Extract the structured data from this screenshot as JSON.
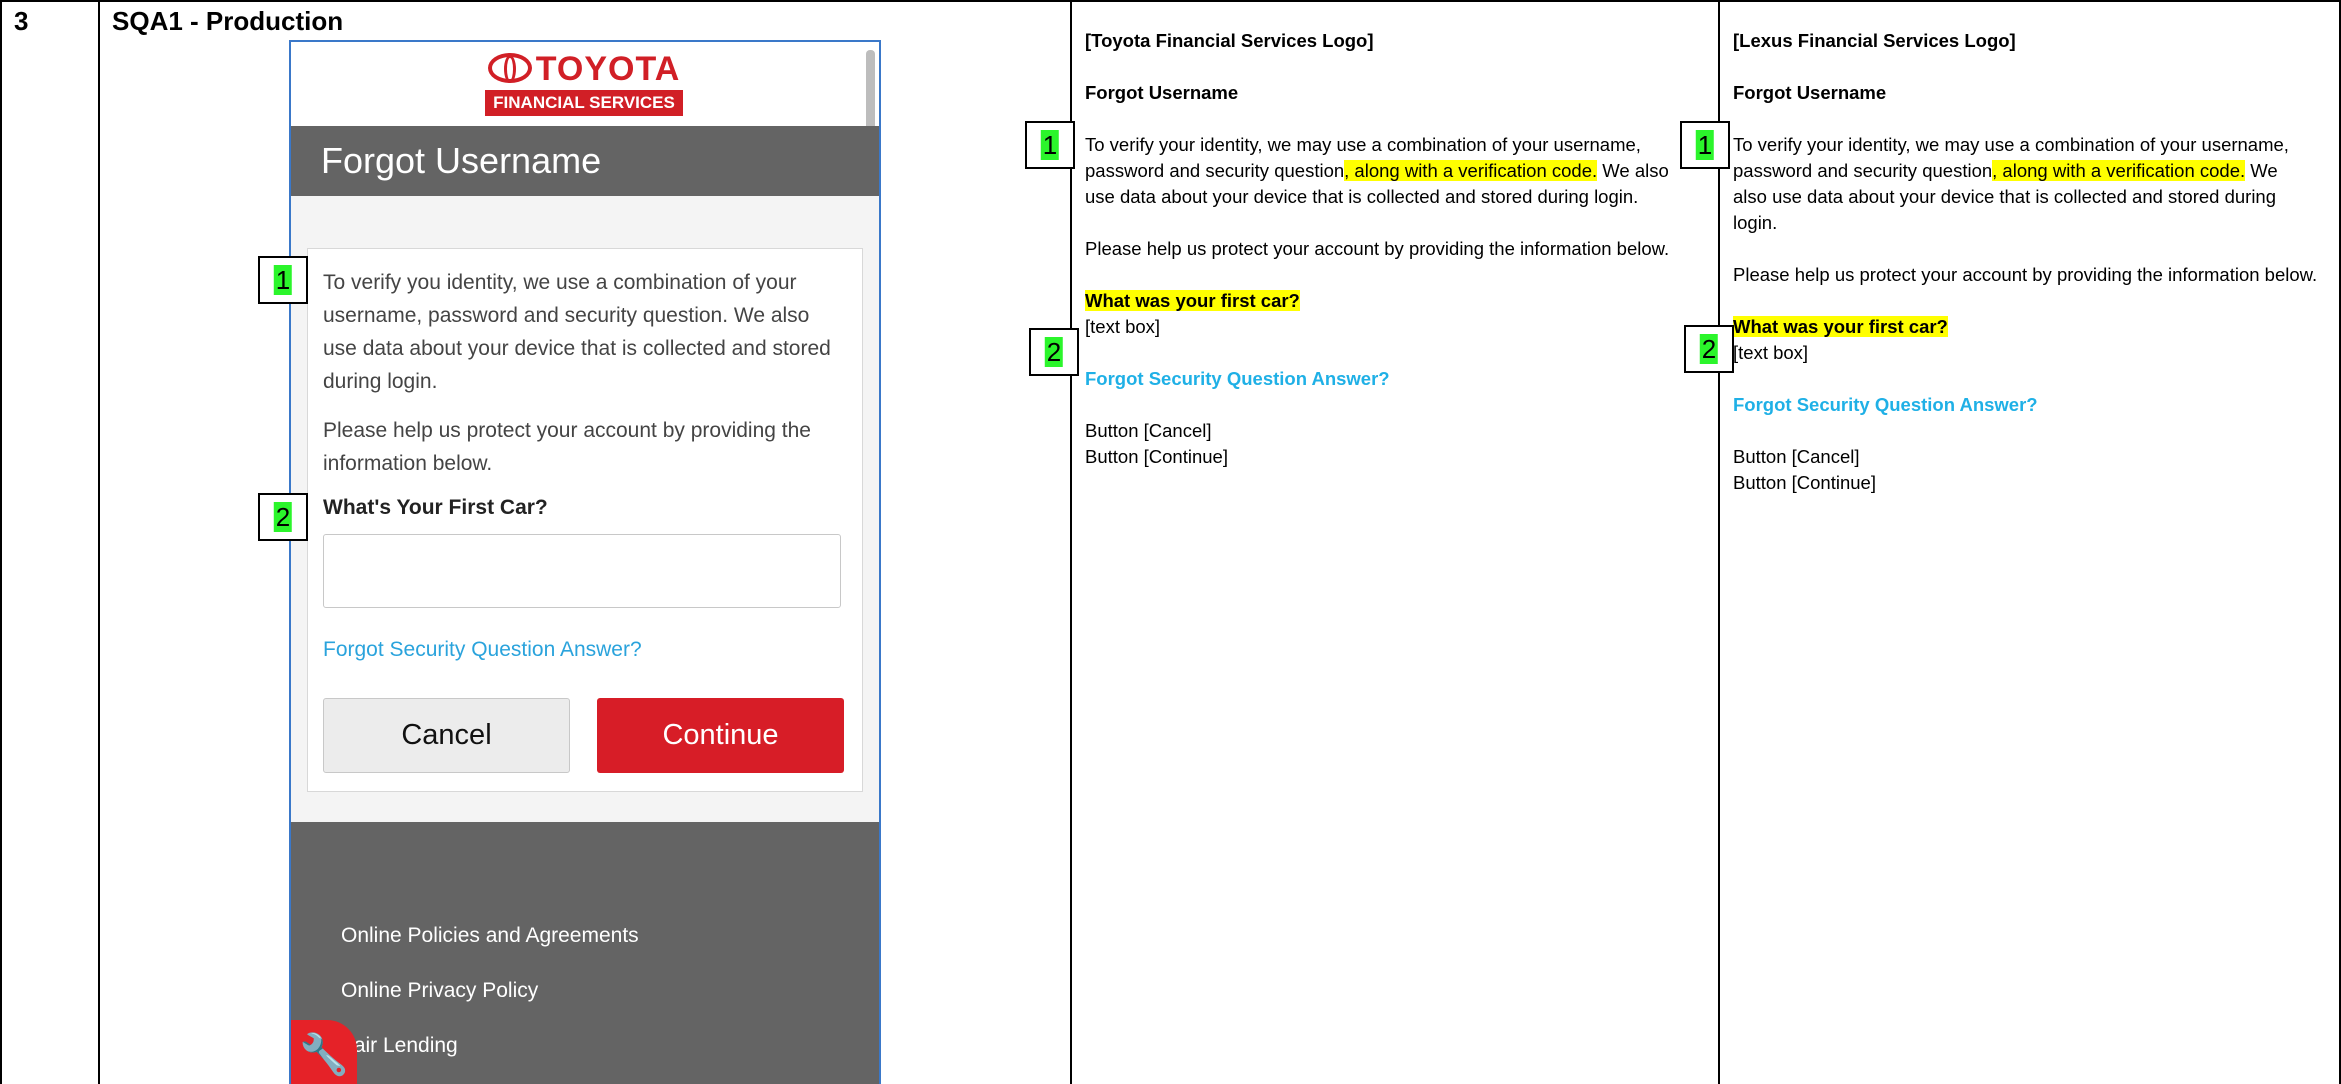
{
  "row": {
    "number": "3",
    "title": "SQA1 - Production"
  },
  "screenshot": {
    "logo": {
      "top": "TOYOTA",
      "bottom": "FINANCIAL SERVICES"
    },
    "page_title": "Forgot Username",
    "intro": "To verify you identity, we use a combination of your username, password and security question. We also use data about your device that is collected and stored during login.",
    "help_text": "Please help us protect your account by providing the information below.",
    "question": "What's Your First Car?",
    "answer_placeholder": "",
    "forgot_link": "Forgot Security Question Answer?",
    "cancel_label": "Cancel",
    "continue_label": "Continue",
    "footer_links": [
      "Online Policies and Agreements",
      "Online Privacy Policy",
      "Fair Lending"
    ],
    "callouts": [
      "1",
      "2"
    ]
  },
  "toyota_spec": {
    "logo_placeholder": "[Toyota Financial Services Logo]",
    "heading": "Forgot Username",
    "intro_plain": "To verify your identity, we may use a combination of your username, password and security question",
    "intro_highlight": ", along with a verification code.",
    "intro_rest": "  We also use data about your device that is collected and stored during login.",
    "help_text": "Please help us protect your account by providing the information below.",
    "question": "What was your first car?",
    "text_box": "[text box]",
    "forgot_link": "Forgot Security Question Answer?",
    "button_cancel": "Button [Cancel]",
    "button_continue": "Button [Continue]",
    "callouts": [
      "1",
      "2"
    ]
  },
  "lexus_spec": {
    "logo_placeholder": "[Lexus Financial Services Logo]",
    "heading": "Forgot Username",
    "intro_plain": "To verify your identity, we may use a combination of your username, password and security question",
    "intro_highlight": ", along with a verification code.",
    "intro_rest": "  We also use data about your device that is collected and stored during login.",
    "help_text": "Please help us protect your account by providing the information below.",
    "question": "What was your first car?",
    "text_box": "[text box]",
    "forgot_link": "Forgot Security Question Answer?",
    "button_cancel": "Button [Cancel]",
    "button_continue": "Button [Continue]",
    "callouts": [
      "1",
      "2"
    ]
  },
  "colors": {
    "toyota_red": "#d11f26",
    "highlight_yellow": "#ffff00",
    "callout_green": "#2bf52b",
    "link_blue": "#1fb0e6"
  }
}
